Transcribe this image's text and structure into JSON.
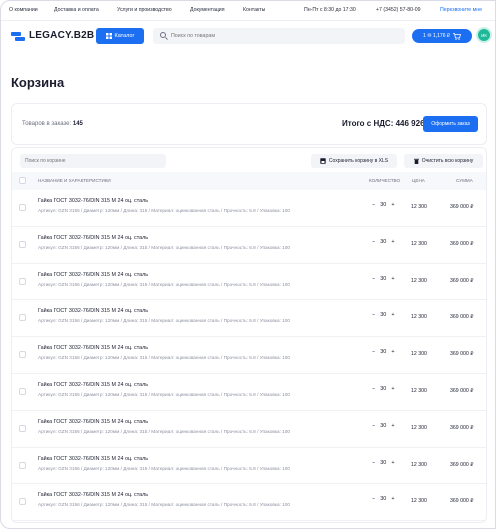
{
  "topbar": {
    "links": [
      "О компании",
      "Доставка и оплата",
      "Услуги и производство",
      "Документация",
      "Контакты"
    ],
    "hours": "Пн-Пт с 8:30 до 17:30",
    "phone": "+7 (3452) 57-80-09",
    "callback": "Перезвоните мне"
  },
  "header": {
    "logo": "LEGACY.B2B",
    "catalog_label": "Каталог",
    "search_placeholder": "Поиск по товарам",
    "cart_label": "1  ⑩  1,176 ₽",
    "avatar_initials": "ИК"
  },
  "page_title": "Корзина",
  "summary": {
    "count_label": "Товаров в заказе:",
    "count_value": "145",
    "total": "Итого с НДС: 446 926 ₽",
    "order_button": "Оформить заказ"
  },
  "toolbar": {
    "search_placeholder": "Поиск по корзине",
    "save_xls": "Сохранить корзину в XLS",
    "clear": "Очистить всю корзину"
  },
  "columns": {
    "name": "Название и характеристики",
    "qty": "Количество",
    "price": "Цена",
    "sum": "Сумма"
  },
  "rows": [
    {
      "name": "Гайка ГОСТ 3032-76/DIN 315 М 24 оц. сталь",
      "meta": "Артикул: GZN 3156 / Диаметр: 120мм / Длина: 315 / Материал: оцинкованная сталь / Прочность: 5.8 / Упаковка: 100",
      "qty": "30",
      "price": "12 300",
      "sum": "369 000 ₽"
    },
    {
      "name": "Гайка ГОСТ 3032-76/DIN 315 М 24 оц. сталь",
      "meta": "Артикул: GZN 3156 / Диаметр: 120мм / Длина: 315 / Материал: оцинкованная сталь / Прочность: 5.8 / Упаковка: 100",
      "qty": "30",
      "price": "12 300",
      "sum": "369 000 ₽"
    },
    {
      "name": "Гайка ГОСТ 3032-76/DIN 315 М 24 оц. сталь",
      "meta": "Артикул: GZN 3156 / Диаметр: 120мм / Длина: 315 / Материал: оцинкованная сталь / Прочность: 5.8 / Упаковка: 100",
      "qty": "30",
      "price": "12 300",
      "sum": "369 000 ₽"
    },
    {
      "name": "Гайка ГОСТ 3032-76/DIN 315 М 24 оц. сталь",
      "meta": "Артикул: GZN 3156 / Диаметр: 120мм / Длина: 315 / Материал: оцинкованная сталь / Прочность: 5.8 / Упаковка: 100",
      "qty": "30",
      "price": "12 300",
      "sum": "369 000 ₽"
    },
    {
      "name": "Гайка ГОСТ 3032-76/DIN 315 М 24 оц. сталь",
      "meta": "Артикул: GZN 3156 / Диаметр: 120мм / Длина: 315 / Материал: оцинкованная сталь / Прочность: 5.8 / Упаковка: 100",
      "qty": "30",
      "price": "12 300",
      "sum": "369 000 ₽"
    },
    {
      "name": "Гайка ГОСТ 3032-76/DIN 315 М 24 оц. сталь",
      "meta": "Артикул: GZN 3156 / Диаметр: 120мм / Длина: 315 / Материал: оцинкованная сталь / Прочность: 5.8 / Упаковка: 100",
      "qty": "30",
      "price": "12 300",
      "sum": "369 000 ₽"
    },
    {
      "name": "Гайка ГОСТ 3032-76/DIN 315 М 24 оц. сталь",
      "meta": "Артикул: GZN 3156 / Диаметр: 120мм / Длина: 315 / Материал: оцинкованная сталь / Прочность: 5.8 / Упаковка: 100",
      "qty": "30",
      "price": "12 300",
      "sum": "369 000 ₽"
    },
    {
      "name": "Гайка ГОСТ 3032-76/DIN 315 М 24 оц. сталь",
      "meta": "Артикул: GZN 3156 / Диаметр: 120мм / Длина: 315 / Материал: оцинкованная сталь / Прочность: 5.8 / Упаковка: 100",
      "qty": "30",
      "price": "12 300",
      "sum": "369 000 ₽"
    },
    {
      "name": "Гайка ГОСТ 3032-76/DIN 315 М 24 оц. сталь",
      "meta": "Артикул: GZN 3156 / Диаметр: 120мм / Длина: 315 / Материал: оцинкованная сталь / Прочность: 5.8 / Упаковка: 100",
      "qty": "30",
      "price": "12 300",
      "sum": "369 000 ₽"
    }
  ],
  "colors": {
    "accent": "#1d6ff2",
    "avatar": "#1fb99a"
  },
  "icons": {
    "catalog": "catalog-icon",
    "search": "search-icon",
    "cart": "cart-icon",
    "save": "save-icon",
    "trash": "trash-icon"
  }
}
